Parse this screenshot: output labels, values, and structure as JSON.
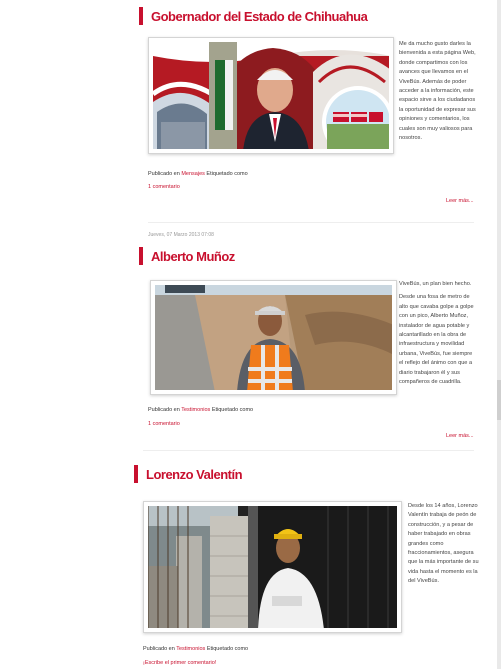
{
  "posts": [
    {
      "title": "Gobernador del Estado de Chihuahua",
      "paragraphs": [
        "Me da mucho gusto darles la bienvenida a esta página Web, donde compartimos con los avances que llevamos en el ViveBús. Además de poder acceder a la información, este espacio sirve a los ciudadanos la oportunidad de expresar sus opiniones y comentarios, los cuales son muy valiosos para nosotros."
      ],
      "published_label": "Publicado en",
      "category": "Mensajes",
      "tagged_label": "Etiquetado como",
      "comments": "1 comentario",
      "read_more": "Leer más..."
    },
    {
      "date": "Jueves, 07 Marzo 2013 07:08",
      "title": "Alberto Muñoz",
      "paragraphs": [
        "ViveBús, un plan bien hecho.",
        "Desde una fosa de metro de alto que cavaba golpe a golpe con un pico, Alberto Muñoz, instalador de agua potable y alcantarillado en la obra de infraestructura y movilidad urbana, ViveBús, fue siempre el reflejo del ánimo con que a diario trabajaron él y sus compañeros de cuadrilla."
      ],
      "published_label": "Publicado en",
      "category": "Testimonios",
      "tagged_label": "Etiquetado como",
      "comments": "1 comentario",
      "read_more": "Leer más..."
    },
    {
      "title": "Lorenzo Valentín",
      "paragraphs": [
        "Desde los 14 años, Lorenzo Valentín trabaja de peón de construcción, y a pesar de haber trabajado en obras grandes como fraccionamientos, asegura que la más importante de su vida hasta el momento es la del ViveBús."
      ],
      "published_label": "Publicado en",
      "category": "Testimonios",
      "tagged_label": "Etiquetado como",
      "comments": "¡Escribe el primer comentario!"
    }
  ],
  "colors": {
    "accent": "#c8102e",
    "text": "#444444",
    "muted": "#999999"
  }
}
